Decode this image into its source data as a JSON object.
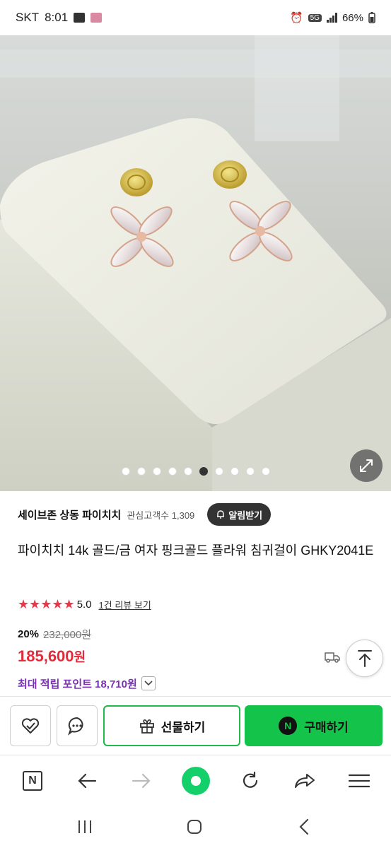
{
  "status_bar": {
    "carrier": "SKT",
    "time": "8:01",
    "network": "5G",
    "battery": "66%"
  },
  "gallery": {
    "dot_count": 10,
    "active_index": 5
  },
  "store": {
    "name": "세이브존 상동 파이치치",
    "followers": "관심고객수 1,309",
    "alert_label": "알림받기"
  },
  "product": {
    "title": "파이치치 14k 골드/금 여자 핑크골드 플라워 침귀걸이 GHKY2041E",
    "stars": "★★★★★",
    "rating": "5.0",
    "review_link": "1건 리뷰 보기",
    "discount": "20%",
    "original_price": "232,000원",
    "price": "185,600",
    "price_unit": "원",
    "points": "최대 적립 포인트 18,710원"
  },
  "actions": {
    "gift_label": "선물하기",
    "buy_label": "구매하기",
    "npay_letter": "N"
  },
  "browser": {
    "home_letter": "N"
  },
  "colors": {
    "price_red": "#e32b3b",
    "points_purple": "#7a2fb5",
    "naver_green": "#13c34a"
  }
}
